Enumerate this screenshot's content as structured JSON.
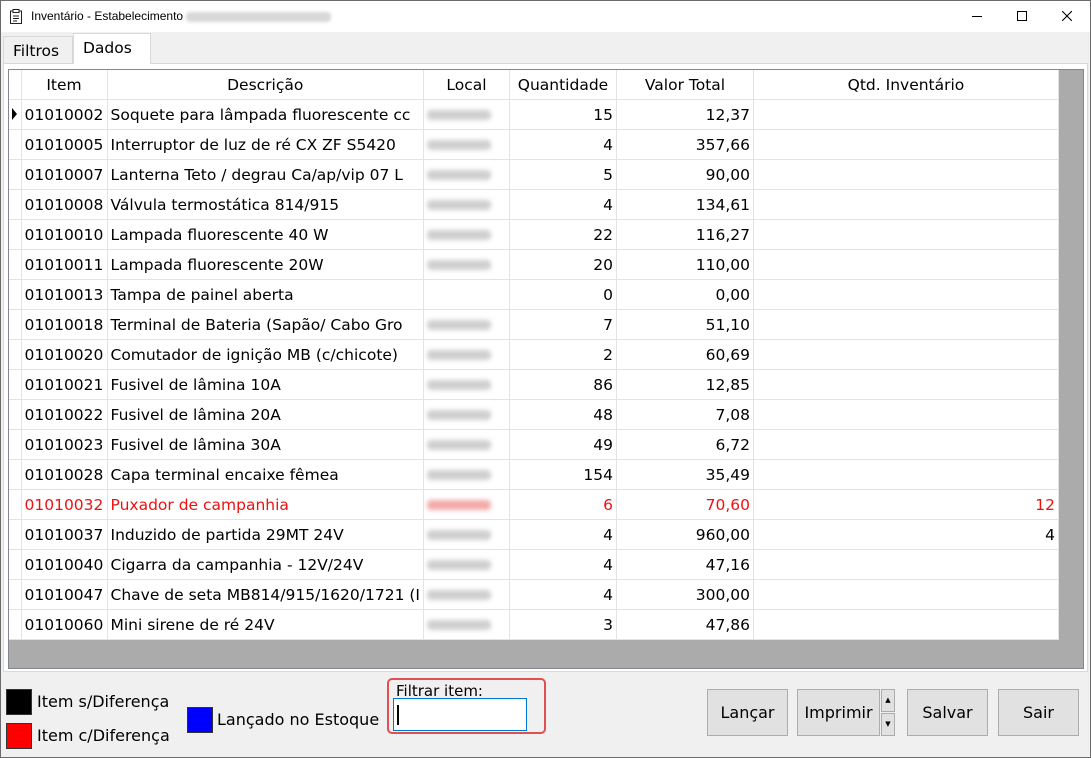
{
  "window": {
    "title": "Inventário - Estabelecimento",
    "minimize_glyph": "—",
    "maximize_glyph": "☐",
    "close_glyph": "✕"
  },
  "tabs": [
    {
      "label": "Filtros",
      "active": false
    },
    {
      "label": "Dados",
      "active": true
    }
  ],
  "table": {
    "columns": [
      "Item",
      "Descrição",
      "Local",
      "Quantidade",
      "Valor Total",
      "Qtd. Inventário"
    ],
    "rows": [
      {
        "item": "01010002",
        "descricao": "Soquete para lâmpada fluorescente cc",
        "quantidade": "15",
        "valor": "12,37",
        "inventario": "",
        "selected": true
      },
      {
        "item": "01010005",
        "descricao": "Interruptor de luz de ré CX ZF S5420",
        "quantidade": "4",
        "valor": "357,66",
        "inventario": ""
      },
      {
        "item": "01010007",
        "descricao": "Lanterna Teto / degrau Ca/ap/vip 07 L",
        "quantidade": "5",
        "valor": "90,00",
        "inventario": ""
      },
      {
        "item": "01010008",
        "descricao": "Válvula termostática 814/915",
        "quantidade": "4",
        "valor": "134,61",
        "inventario": ""
      },
      {
        "item": "01010010",
        "descricao": "Lampada fluorescente 40 W",
        "quantidade": "22",
        "valor": "116,27",
        "inventario": ""
      },
      {
        "item": "01010011",
        "descricao": "Lampada fluorescente 20W",
        "quantidade": "20",
        "valor": "110,00",
        "inventario": ""
      },
      {
        "item": "01010013",
        "descricao": "Tampa de painel aberta",
        "quantidade": "0",
        "valor": "0,00",
        "inventario": "",
        "no_local": true
      },
      {
        "item": "01010018",
        "descricao": "Terminal de Bateria (Sapão/ Cabo Gro",
        "quantidade": "7",
        "valor": "51,10",
        "inventario": ""
      },
      {
        "item": "01010020",
        "descricao": "Comutador de ignição MB (c/chicote)",
        "quantidade": "2",
        "valor": "60,69",
        "inventario": ""
      },
      {
        "item": "01010021",
        "descricao": "Fusivel de lâmina 10A",
        "quantidade": "86",
        "valor": "12,85",
        "inventario": ""
      },
      {
        "item": "01010022",
        "descricao": "Fusivel de lâmina 20A",
        "quantidade": "48",
        "valor": "7,08",
        "inventario": ""
      },
      {
        "item": "01010023",
        "descricao": "Fusivel de lâmina 30A",
        "quantidade": "49",
        "valor": "6,72",
        "inventario": ""
      },
      {
        "item": "01010028",
        "descricao": "Capa terminal encaixe fêmea",
        "quantidade": "154",
        "valor": "35,49",
        "inventario": ""
      },
      {
        "item": "01010032",
        "descricao": "Puxador de campanhia",
        "quantidade": "6",
        "valor": "70,60",
        "inventario": "12",
        "diff": true
      },
      {
        "item": "01010037",
        "descricao": "Induzido de partida  29MT 24V",
        "quantidade": "4",
        "valor": "960,00",
        "inventario": "4"
      },
      {
        "item": "01010040",
        "descricao": "Cigarra da campanhia - 12V/24V",
        "quantidade": "4",
        "valor": "47,16",
        "inventario": ""
      },
      {
        "item": "01010047",
        "descricao": "Chave de seta MB814/915/1620/1721 (I",
        "quantidade": "4",
        "valor": "300,00",
        "inventario": ""
      },
      {
        "item": "01010060",
        "descricao": "Mini sirene de ré 24V",
        "quantidade": "3",
        "valor": "47,86",
        "inventario": ""
      }
    ]
  },
  "legend": {
    "sem_diferenca": {
      "label": "Item s/Diferença",
      "color": "#000000"
    },
    "com_diferenca": {
      "label": "Item c/Diferença",
      "color": "#ff0000"
    },
    "lancado": {
      "label": "Lançado no Estoque",
      "color": "#0000ff"
    }
  },
  "filter": {
    "label": "Filtrar item:",
    "value": ""
  },
  "buttons": {
    "lancar": "Lançar",
    "imprimir": "Imprimir",
    "salvar": "Salvar",
    "sair": "Sair"
  },
  "colors": {
    "diff_text": "#ee1111",
    "highlight_border": "#e05050",
    "focus_border": "#0078d7"
  }
}
